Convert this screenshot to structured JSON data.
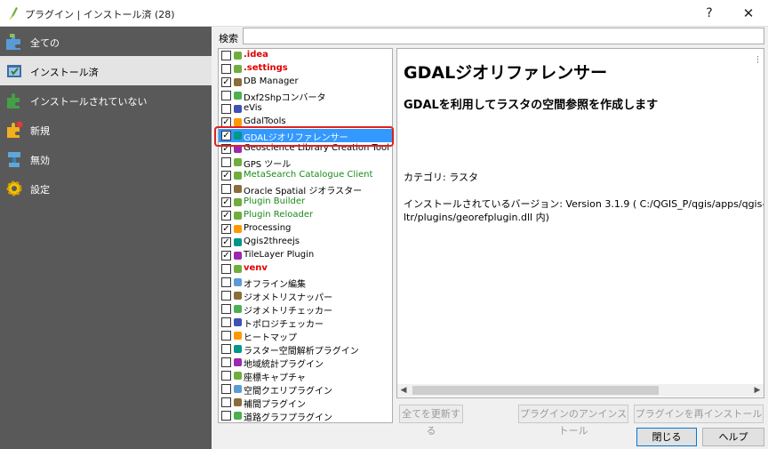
{
  "window": {
    "title": "プラグイン | インストール済 (28)",
    "help_glyph": "?",
    "close_glyph": "✕"
  },
  "sidebar": {
    "items": [
      {
        "label": "全ての",
        "icon": "puzzle-all-icon"
      },
      {
        "label": "インストール済",
        "icon": "installed-plugins-icon"
      },
      {
        "label": "インストールされていない",
        "icon": "not-installed-icon"
      },
      {
        "label": "新規",
        "icon": "new-plugin-icon"
      },
      {
        "label": "無効",
        "icon": "invalid-plugin-icon"
      },
      {
        "label": "設定",
        "icon": "gear-icon"
      }
    ],
    "active_index": 1
  },
  "search": {
    "label": "検索",
    "value": ""
  },
  "plugins": [
    {
      "name": ".idea",
      "checked": false,
      "style": "red"
    },
    {
      "name": ".settings",
      "checked": false,
      "style": "red"
    },
    {
      "name": "DB Manager",
      "checked": true,
      "style": "normal"
    },
    {
      "name": "Dxf2Shpコンバータ",
      "checked": false,
      "style": "normal"
    },
    {
      "name": "eVis",
      "checked": false,
      "style": "normal"
    },
    {
      "name": "GdalTools",
      "checked": true,
      "style": "normal"
    },
    {
      "name": "GDALジオリファレンサー",
      "checked": true,
      "style": "normal",
      "selected": true
    },
    {
      "name": "Geoscience Library Creation Tool",
      "checked": true,
      "style": "normal"
    },
    {
      "name": "GPS ツール",
      "checked": false,
      "style": "normal"
    },
    {
      "name": "MetaSearch Catalogue Client",
      "checked": true,
      "style": "green"
    },
    {
      "name": "Oracle Spatial ジオラスター",
      "checked": false,
      "style": "normal"
    },
    {
      "name": "Plugin Builder",
      "checked": true,
      "style": "green"
    },
    {
      "name": "Plugin Reloader",
      "checked": true,
      "style": "green"
    },
    {
      "name": "Processing",
      "checked": true,
      "style": "normal"
    },
    {
      "name": "Qgis2threejs",
      "checked": true,
      "style": "normal"
    },
    {
      "name": "TileLayer Plugin",
      "checked": true,
      "style": "normal"
    },
    {
      "name": "venv",
      "checked": false,
      "style": "red"
    },
    {
      "name": "オフライン編集",
      "checked": false,
      "style": "normal"
    },
    {
      "name": "ジオメトリスナッパー",
      "checked": false,
      "style": "normal"
    },
    {
      "name": "ジオメトリチェッカー",
      "checked": false,
      "style": "normal"
    },
    {
      "name": "トポロジチェッカー",
      "checked": false,
      "style": "normal"
    },
    {
      "name": "ヒートマップ",
      "checked": false,
      "style": "normal"
    },
    {
      "name": "ラスター空間解析プラグイン",
      "checked": false,
      "style": "normal"
    },
    {
      "name": "地域統計プラグイン",
      "checked": false,
      "style": "normal"
    },
    {
      "name": "座標キャプチャ",
      "checked": false,
      "style": "normal"
    },
    {
      "name": "空間クエリプラグイン",
      "checked": false,
      "style": "normal"
    },
    {
      "name": "補間プラグイン",
      "checked": false,
      "style": "normal"
    },
    {
      "name": "道路グラフプラグイン",
      "checked": false,
      "style": "normal"
    }
  ],
  "detail": {
    "title": "GDALジオリファレンサー",
    "description": "GDALを利用してラスタの空間参照を作成します",
    "category": "カテゴリ: ラスタ",
    "version_line1": "インストールされているバージョン: Version 3.1.9 ( C:/QGIS_P/qgis/apps/qgis-",
    "version_line2": "ltr/plugins/georefplugin.dll 内)"
  },
  "buttons": {
    "upgrade_all": "全てを更新する",
    "uninstall": "プラグインのアンインストール",
    "reinstall": "プラグインを再インストール",
    "close": "閉じる",
    "help": "ヘルプ"
  },
  "colors": {
    "sidebar_bg": "#595959",
    "selection": "#3399ff",
    "error_red": "#e00000",
    "trusted_green": "#1a8a1a",
    "highlight_frame": "#e02020"
  }
}
